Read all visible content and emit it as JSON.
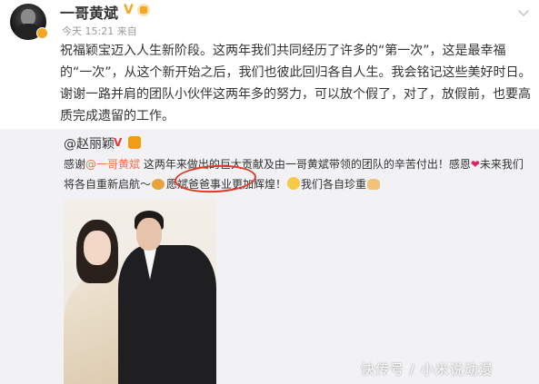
{
  "post": {
    "username": "一哥黄斌",
    "timestamp": "今天 15:21 来自",
    "text": "祝福颖宝迈入人生新阶段。这两年我们共同经历了许多的“第一次”，这是最幸福的“一次”，从这个新开始之后，我们也彼此回归各自人生。我会铭记这些美好时日。谢谢一路并肩的团队小伙伴这两年多的努力，可以放个假了，对了，放假前，也要高质完成遗留的工作。"
  },
  "repost": {
    "author": "@赵丽颖",
    "text_before_mention": "感谢",
    "mention": "@一哥黄斌",
    "text_after_mention": " 这两年来做出的巨大贡献及由一哥黄斌带领的团队的辛苦付出！感恩",
    "text_line2_start": "未来我们将各自重新启航～",
    "text_circled": "愿斌爸爸事业更加辉煌！",
    "text_end": "我们各自珍重",
    "heart": "❤"
  },
  "watermark": "快传号 / 小米说动漫",
  "colors": {
    "mention": "#eb7350",
    "circle": "#e03a24",
    "repost_bg": "#f2f2f5"
  }
}
